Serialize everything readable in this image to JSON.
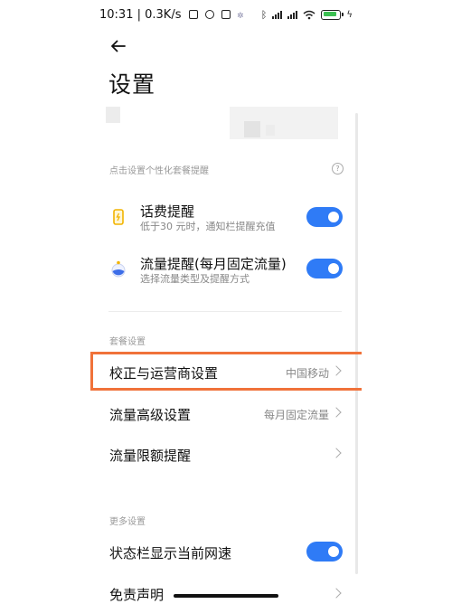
{
  "status_bar": {
    "time": "10:31",
    "speed": "0.3K/s"
  },
  "header": {
    "title": "设置"
  },
  "tips": {
    "hint": "点击设置个性化套餐提醒",
    "help_icon": "question-circle-icon"
  },
  "reminders": [
    {
      "title": "话费提醒",
      "subtitle": "低于30 元时，通知栏提醒充值",
      "icon": "phone-bill-icon",
      "enabled": true
    },
    {
      "title": "流量提醒(每月固定流量)",
      "subtitle": "选择流量类型及提醒方式",
      "icon": "data-drop-icon",
      "enabled": true
    }
  ],
  "package_settings": {
    "section_title": "套餐设置",
    "items": [
      {
        "label": "校正与运营商设置",
        "value": "中国移动"
      },
      {
        "label": "流量高级设置",
        "value": "每月固定流量"
      },
      {
        "label": "流量限额提醒",
        "value": ""
      }
    ]
  },
  "more_settings": {
    "section_title": "更多设置",
    "items": [
      {
        "label": "状态栏显示当前网速",
        "enabled": true
      },
      {
        "label": "免责声明"
      }
    ]
  },
  "colors": {
    "toggle_on": "#2f7bf6",
    "highlight_border": "#f0723a",
    "battery_green": "#3cc052"
  }
}
